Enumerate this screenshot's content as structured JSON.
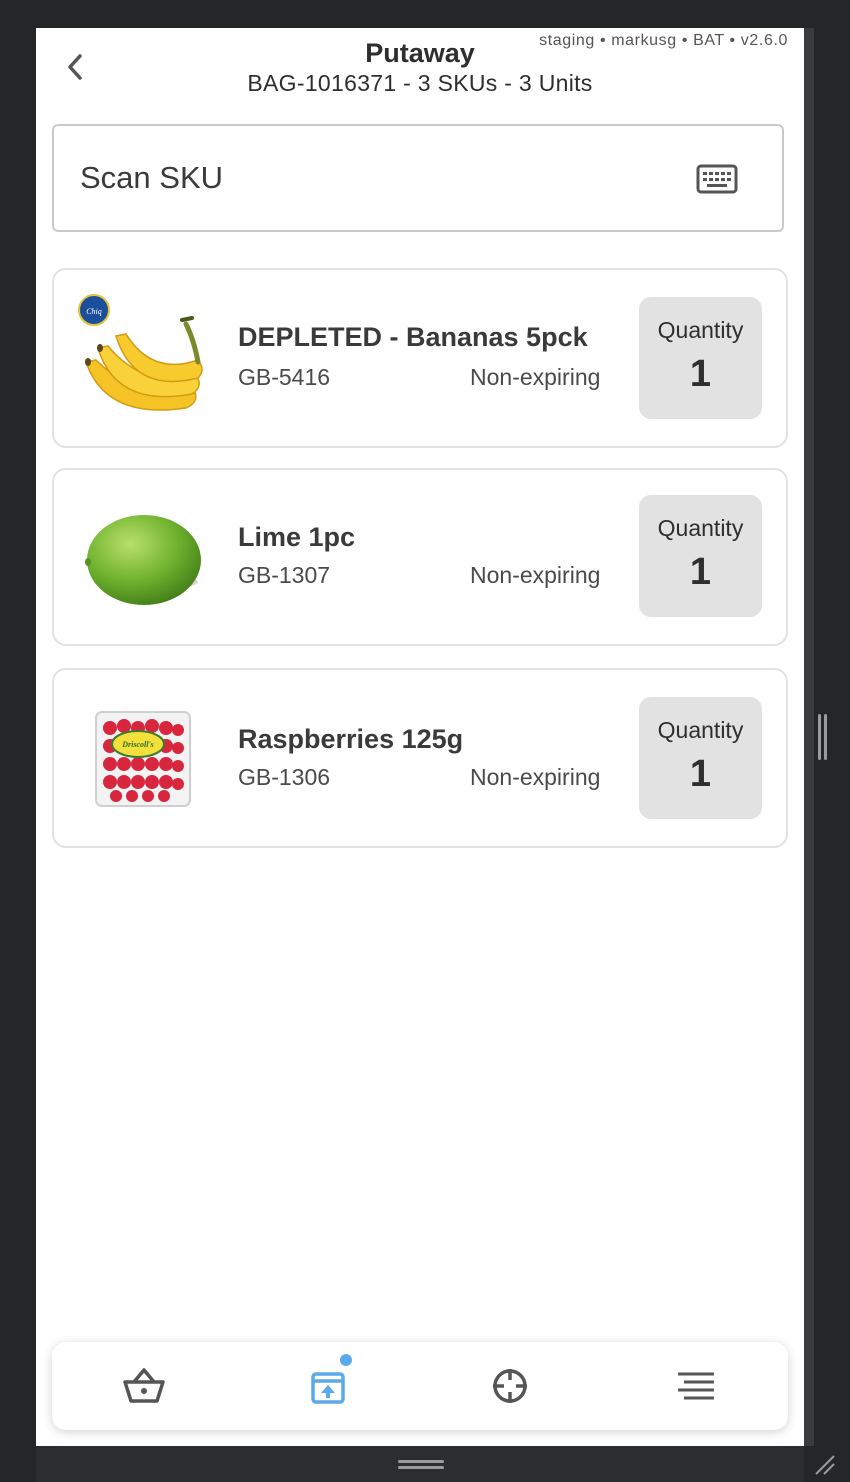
{
  "header": {
    "title": "Putaway",
    "subtitle": "BAG-1016371 - 3 SKUs - 3 Units",
    "env_info": "staging • markusg • BAT • v2.6.0"
  },
  "scan": {
    "placeholder": "Scan SKU",
    "keyboard_icon": "keyboard-icon"
  },
  "items": [
    {
      "name": "DEPLETED - Bananas 5pck",
      "sku": "GB-5416",
      "expiry": "Non-expiring",
      "quantity_label": "Quantity",
      "quantity": "1",
      "image": "bananas-image",
      "brand_badge": "Chiquita"
    },
    {
      "name": "Lime 1pc",
      "sku": "GB-1307",
      "expiry": "Non-expiring",
      "quantity_label": "Quantity",
      "quantity": "1",
      "image": "lime-image"
    },
    {
      "name": "Raspberries 125g",
      "sku": "GB-1306",
      "expiry": "Non-expiring",
      "quantity_label": "Quantity",
      "quantity": "1",
      "image": "raspberries-image",
      "brand_label": "Driscoll's"
    }
  ],
  "nav": {
    "items": [
      {
        "icon": "basket-icon",
        "active": false
      },
      {
        "icon": "putaway-box-icon",
        "active": true,
        "badge": true
      },
      {
        "icon": "crosshair-icon",
        "active": false
      },
      {
        "icon": "menu-icon",
        "active": false
      }
    ]
  },
  "colors": {
    "accent": "#5aa9e8",
    "text": "#2e2e2e",
    "quantity_bg": "#e2e2e2",
    "frame": "#252628"
  }
}
